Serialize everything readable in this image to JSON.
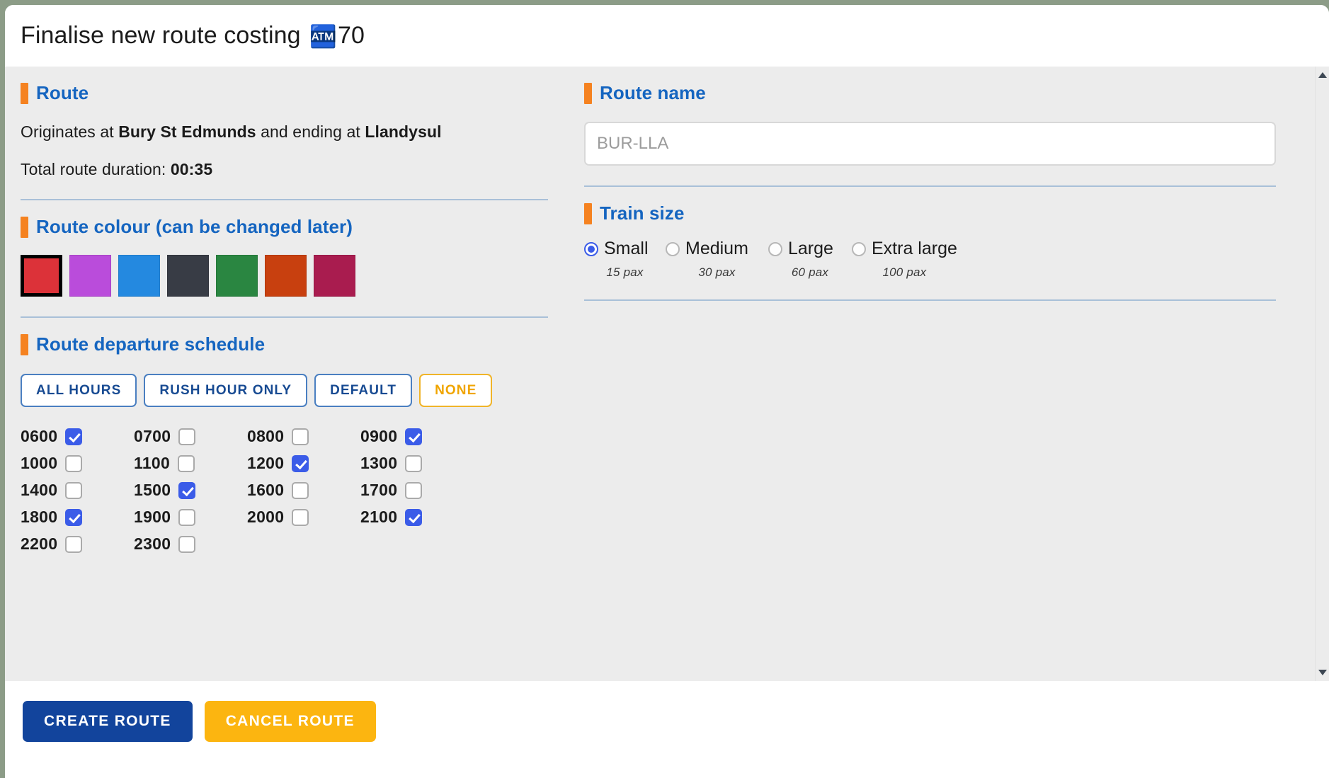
{
  "window": {
    "title_prefix": "Finalise new route",
    "title_costing_label": "costing",
    "costing_icon": "cash-register-icon",
    "costing_icon_glyph": "🏧",
    "costing_value": "70"
  },
  "theme": {
    "backdrop": "#8c9c87",
    "panel_bg": "#ececec",
    "accent_bar": "#f58220",
    "heading_blue": "#1565c0",
    "divider": "#a9c0d8",
    "checkbox_on": "#3b5ce8",
    "primary_button": "#12449c",
    "warn_button": "#fcb510",
    "preset_blue": "#174a92",
    "preset_amber": "#f0a500"
  },
  "route_section": {
    "heading": "Route",
    "origin_prefix": "Originates at ",
    "origin": "Bury St Edmunds",
    "middle": " and ending at ",
    "destination": "Llandysul",
    "duration_label": "Total route duration: ",
    "duration_value": "00:35"
  },
  "route_name_section": {
    "heading": "Route name",
    "input_value": "",
    "input_placeholder": "BUR-LLA"
  },
  "colour_section": {
    "heading": "Route colour (can be changed later)",
    "selected_index": 0,
    "swatches": [
      {
        "name": "red",
        "hex": "#dc3239",
        "selected": true
      },
      {
        "name": "purple",
        "hex": "#ba4cdb",
        "selected": false
      },
      {
        "name": "blue",
        "hex": "#2489e0",
        "selected": false
      },
      {
        "name": "dark-slate",
        "hex": "#383c45",
        "selected": false
      },
      {
        "name": "green",
        "hex": "#2a8641",
        "selected": false
      },
      {
        "name": "orange",
        "hex": "#c8400f",
        "selected": false
      },
      {
        "name": "crimson",
        "hex": "#a91c4f",
        "selected": false
      }
    ]
  },
  "train_size_section": {
    "heading": "Train size",
    "selected": "Small",
    "options": [
      {
        "label": "Small",
        "capacity": "15 pax",
        "selected": true
      },
      {
        "label": "Medium",
        "capacity": "30 pax",
        "selected": false
      },
      {
        "label": "Large",
        "capacity": "60 pax",
        "selected": false
      },
      {
        "label": "Extra large",
        "capacity": "100 pax",
        "selected": false
      }
    ]
  },
  "schedule_section": {
    "heading": "Route departure schedule",
    "presets": [
      {
        "label": "ALL HOURS",
        "style": "blue"
      },
      {
        "label": "RUSH HOUR ONLY",
        "style": "blue"
      },
      {
        "label": "DEFAULT",
        "style": "blue"
      },
      {
        "label": "NONE",
        "style": "amber"
      }
    ],
    "hours": [
      {
        "label": "0600",
        "checked": true
      },
      {
        "label": "0700",
        "checked": false
      },
      {
        "label": "0800",
        "checked": false
      },
      {
        "label": "0900",
        "checked": true
      },
      {
        "label": "1000",
        "checked": false
      },
      {
        "label": "1100",
        "checked": false
      },
      {
        "label": "1200",
        "checked": true
      },
      {
        "label": "1300",
        "checked": false
      },
      {
        "label": "1400",
        "checked": false
      },
      {
        "label": "1500",
        "checked": true
      },
      {
        "label": "1600",
        "checked": false
      },
      {
        "label": "1700",
        "checked": false
      },
      {
        "label": "1800",
        "checked": true
      },
      {
        "label": "1900",
        "checked": false
      },
      {
        "label": "2000",
        "checked": false
      },
      {
        "label": "2100",
        "checked": true
      },
      {
        "label": "2200",
        "checked": false
      },
      {
        "label": "2300",
        "checked": false
      }
    ]
  },
  "footer": {
    "create_label": "CREATE ROUTE",
    "cancel_label": "CANCEL ROUTE"
  },
  "scrollbar": {
    "up_icon": "scroll-up-arrow-icon",
    "down_icon": "scroll-down-arrow-icon"
  }
}
